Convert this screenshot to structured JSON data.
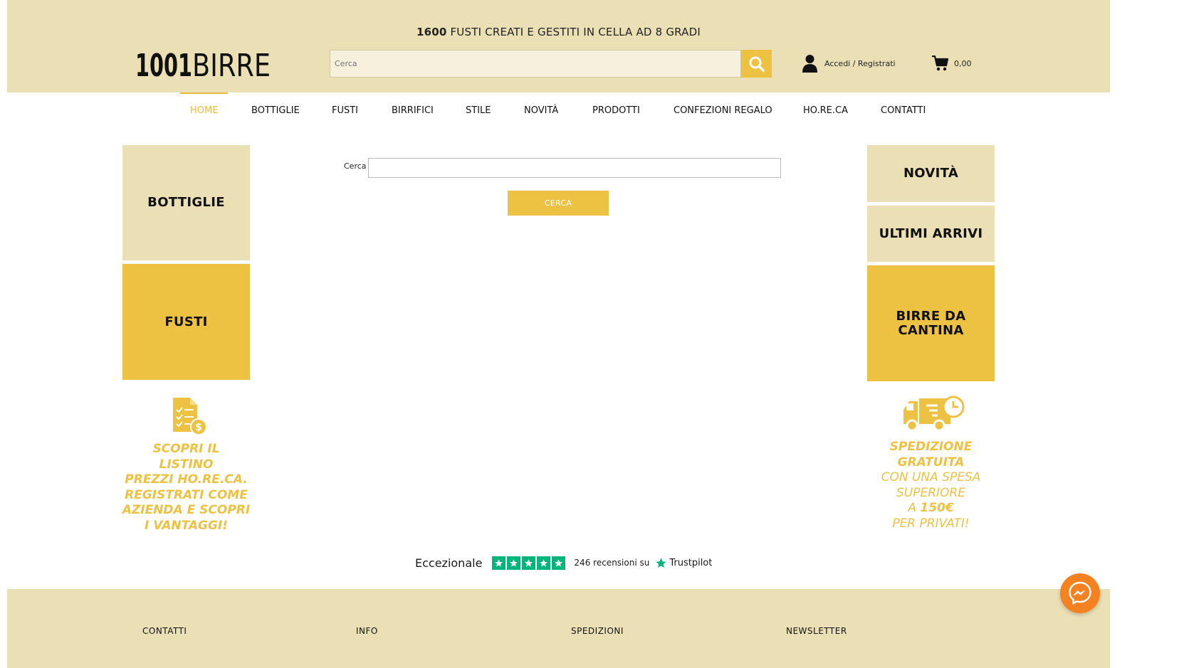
{
  "header": {
    "tagline_bold": "1600",
    "tagline_rest": " FUSTI CREATI E GESTITI IN CELLA AD 8 GRADI",
    "logo_text": "1001BIRRE",
    "search_placeholder": "Cerca",
    "account_label": "Accedi / Registrati",
    "cart_total": "0,00"
  },
  "nav": {
    "items": [
      "HOME",
      "BOTTIGLIE",
      "FUSTI",
      "BIRRIFICI",
      "STILE",
      "NOVITÀ",
      "PRODOTTI",
      "CONFEZIONI REGALO",
      "HO.RE.CA",
      "CONTATTI"
    ],
    "active": "HOME"
  },
  "left_tiles": [
    "BOTTIGLIE",
    "FUSTI"
  ],
  "right_tiles": [
    "NOVITÀ",
    "ULTIMI ARRIVI",
    "BIRRE DA\nCANTINA"
  ],
  "promo_left": {
    "lines": [
      "SCOPRI IL",
      "LISTINO",
      "PREZZI HO.RE.CA.",
      "REGISTRATI COME",
      "AZIENDA E SCOPRI",
      "I VANTAGGI!"
    ]
  },
  "promo_right": {
    "line1": "SPEDIZIONE",
    "line2": "GRATUITA",
    "line3": "CON UNA SPESA",
    "line4": "SUPERIORE",
    "line5_pre": "A ",
    "line5_bold": "150€",
    "line6": "PER PRIVATI!"
  },
  "search_form": {
    "label": "Cerca",
    "button": "CERCA",
    "value": ""
  },
  "trustpilot": {
    "rating_word": "Eccezionale",
    "review_count": "246",
    "reviews_suffix": "recensioni su",
    "brand": "Trustpilot"
  },
  "footer": {
    "headings": [
      "CONTATTI",
      "INFO",
      "SPEDIZIONI",
      "NEWSLETTER"
    ]
  },
  "colors": {
    "header_bg": "#ebdfb5",
    "gold": "#edc141",
    "trustpilot_green": "#00b67a",
    "messenger_orange": "#f58220"
  }
}
